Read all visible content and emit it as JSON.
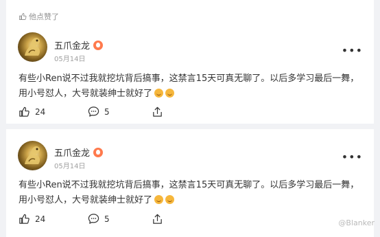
{
  "feed": {
    "liked_label": "他点赞了",
    "posts": [
      {
        "username": "五爪金龙",
        "date": "05月14日",
        "more_label": "•••",
        "content_line1": "有些小Ren说不过我就挖坑背后搞事，这禁言15天可真无聊了。以后多学习最后一舞，",
        "content_line2": "用小号怼人，大号就装绅士就好了",
        "likes": "24",
        "comments": "5"
      },
      {
        "username": "五爪金龙",
        "date": "05月14日",
        "more_label": "•••",
        "content_line1": "有些小Ren说不过我就挖坑背后搞事，这禁言15天可真无聊了。以后多学习最后一舞，",
        "content_line2": "用小号怼人，大号就装绅士就好了",
        "likes": "24",
        "comments": "5"
      }
    ]
  },
  "watermark": "@Blanker",
  "colors": {
    "background": "#f1f2f5",
    "card": "#ffffff",
    "vip_badge": "#ff7a4d",
    "muted_text": "#939393"
  }
}
